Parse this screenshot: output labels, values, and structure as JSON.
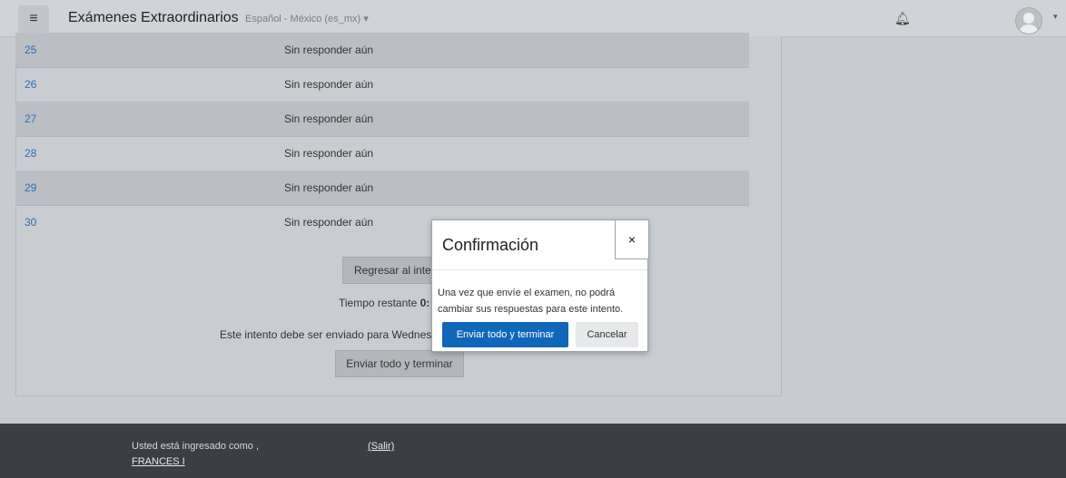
{
  "navbar": {
    "menu_icon": "≡",
    "site_name": "Exámenes Extraordinarios",
    "language": "Español - México (es_mx) ▾",
    "bell_icon": "♪",
    "user_caret": "▾"
  },
  "summary": {
    "rows": [
      {
        "number": "25",
        "status": "Sin responder aún"
      },
      {
        "number": "26",
        "status": "Sin responder aún"
      },
      {
        "number": "27",
        "status": "Sin responder aún"
      },
      {
        "number": "28",
        "status": "Sin responder aún"
      },
      {
        "number": "29",
        "status": "Sin responder aún"
      },
      {
        "number": "30",
        "status": "Sin responder aún"
      }
    ],
    "back_button": "Regresar al inte",
    "time_label": "Tiempo restante ",
    "time_value": "0:",
    "due_text": "Este intento debe ser enviado para Wednes",
    "submit_button": "Enviar todo y terminar"
  },
  "modal": {
    "title": "Confirmación",
    "close": "×",
    "body": "Una vez que envíe el examen, no podrá cambiar sus respuestas para este intento.",
    "confirm_button": "Enviar todo y terminar",
    "cancel_button": "Cancelar",
    "accent": "#1067b9"
  },
  "footer": {
    "logged_in_as": "Usted está ingresado como ,",
    "user_name": "FRANCES I",
    "logout": "(Salir)"
  }
}
